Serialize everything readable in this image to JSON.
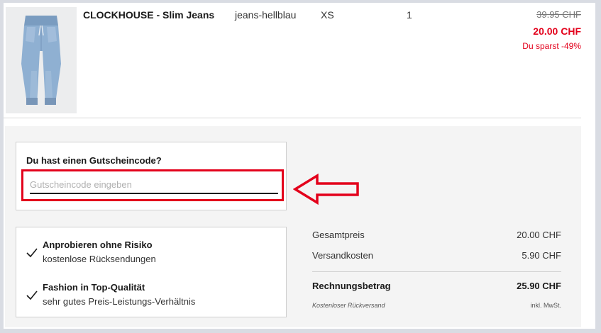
{
  "product": {
    "name": "CLOCKHOUSE - Slim Jeans",
    "color": "jeans-hellblau",
    "size": "XS",
    "quantity": "1",
    "price_old": "39.95 CHF",
    "price_new": "20.00 CHF",
    "savings": "Du sparst -49%",
    "image_icon": "jeans-product-image"
  },
  "voucher": {
    "title": "Du hast einen Gutscheincode?",
    "placeholder": "Gutscheincode eingeben",
    "value": ""
  },
  "annotation": {
    "color": "#e3001b",
    "icon": "left-arrow-icon"
  },
  "benefits": [
    {
      "title": "Anprobieren ohne Risiko",
      "subtitle": "kostenlose Rücksendungen",
      "icon": "check-icon"
    },
    {
      "title": "Fashion in Top-Qualität",
      "subtitle": "sehr gutes Preis-Leistungs-Verhältnis",
      "icon": "check-icon"
    }
  ],
  "summary": {
    "subtotal_label": "Gesamtpreis",
    "subtotal_value": "20.00 CHF",
    "shipping_label": "Versandkosten",
    "shipping_value": "5.90 CHF",
    "total_label": "Rechnungsbetrag",
    "total_value": "25.90 CHF",
    "return_note": "Kostenloser Rückversand",
    "vat_note": "inkl. MwSt."
  },
  "colors": {
    "accent_red": "#e3001b",
    "panel_bg": "#f4f4f4",
    "outer_bg": "#d9dce3"
  }
}
